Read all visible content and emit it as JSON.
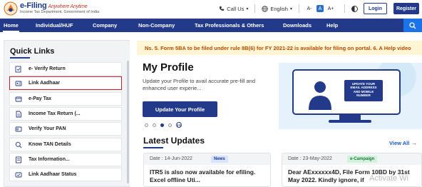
{
  "header": {
    "logo_title": "e-Filing",
    "logo_tagline": "Anywhere Anytime",
    "logo_subtitle": "Income Tax Department, Government of India",
    "call_us": "Call Us",
    "language": "English",
    "font_decrease": "A-",
    "font_normal": "A",
    "font_increase": "A+",
    "login": "Login",
    "register": "Register"
  },
  "nav": {
    "items": [
      "Home",
      "Individual/HUF",
      "Company",
      "Non-Company",
      "Tax Professionals & Others",
      "Downloads",
      "Help"
    ]
  },
  "quick_links": {
    "title": "Quick Links",
    "items": [
      {
        "label": "e- Verify Return",
        "icon": "verify-icon"
      },
      {
        "label": "Link Aadhaar",
        "icon": "link-icon"
      },
      {
        "label": "e-Pay Tax",
        "icon": "pay-icon"
      },
      {
        "label": "Income Tax Return (...",
        "icon": "itr-icon"
      },
      {
        "label": "Verify Your PAN",
        "icon": "pan-icon"
      },
      {
        "label": "Know TAN Details",
        "icon": "tan-icon"
      },
      {
        "label": "Tax Information...",
        "icon": "info-icon"
      },
      {
        "label": "Link Aadhaar Status",
        "icon": "status-icon"
      }
    ]
  },
  "ticker": {
    "text": "Ns. 5. Form 5BA to be filed under rule 8B(6) for FY 2021-22 is available for filing on portal. 6. A Help video"
  },
  "profile": {
    "title": "My Profile",
    "description": "Update your Profile to avail accurate pre-fill and enhanced user experie...",
    "button": "Update Your Profile"
  },
  "promo": {
    "text": "UPDATE YOUR EMAIL ADDRESS AND MOBILE NUMBER"
  },
  "latest_updates": {
    "title": "Latest Updates",
    "view_all": "View All",
    "cards": [
      {
        "date": "Date : 14-Jun-2022",
        "badge": "News",
        "text": "ITR5 is also now available for efiling. Excel offline Uti..."
      },
      {
        "date": "Date : 23-May-2022",
        "badge": "e-Campaign",
        "text": "Dear AExxxxxx4D, File Form 10BD by 31st May 2022. Kindly ignore, if"
      }
    ]
  },
  "watermark": "Activate Wi",
  "colors": {
    "primary": "#233a8a",
    "search_bg": "#1a73e8",
    "highlight_border": "#c8202a",
    "ticker_bg": "#fff4d3",
    "ticker_text": "#b44d00",
    "promo_bg": "#e5f2fb"
  }
}
